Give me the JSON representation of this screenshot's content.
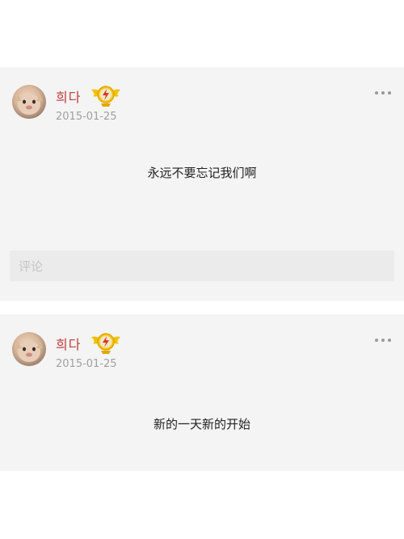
{
  "posts": [
    {
      "username": "희다",
      "date": "2015-01-25",
      "text": "永远不要忘记我们啊",
      "comment_placeholder": "评论"
    },
    {
      "username": "희다",
      "date": "2015-01-25",
      "text": "新的一天新的开始"
    }
  ],
  "colors": {
    "username": "#c23a3a",
    "date": "#a0a0a0",
    "card_bg": "#f4f4f4",
    "badge_gold": "#f2c200",
    "badge_red": "#d8362b"
  },
  "icons": {
    "badge": "winged-lightning-badge-icon",
    "more": "more-options-icon"
  }
}
